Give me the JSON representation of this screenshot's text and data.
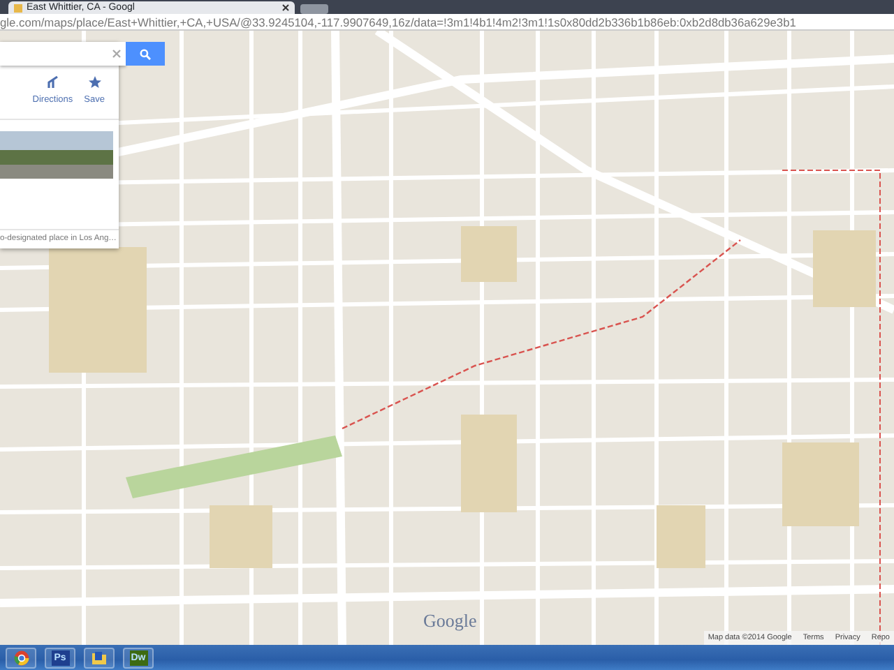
{
  "browser": {
    "tabs": [
      {
        "title": "East Whittier, CA - Googl",
        "selected": true
      }
    ],
    "address": "gle.com/maps/place/East+Whittier,+CA,+USA/@33.9245104,-117.9907649,16z/data=!3m1!4b1!4m2!3m1!1s0x80dd2b336b1b86eb:0xb2d8db36a629e3b1"
  },
  "panel": {
    "actions": [
      {
        "kind": "directions",
        "label": "Directions"
      },
      {
        "kind": "save",
        "label": "Save"
      }
    ],
    "description": "o-designated place in Los Ang…"
  },
  "map": {
    "logo": "Google",
    "footer": [
      "Map data ©2014 Google",
      "Terms",
      "Privacy",
      "Repo"
    ]
  },
  "taskbar": [
    {
      "kind": "round"
    },
    {
      "kind": "letter",
      "label": "Ps",
      "color": "#1e3f8f"
    },
    {
      "kind": "folder"
    },
    {
      "kind": "letter",
      "label": "Dw",
      "color": "#3d6b12"
    }
  ]
}
